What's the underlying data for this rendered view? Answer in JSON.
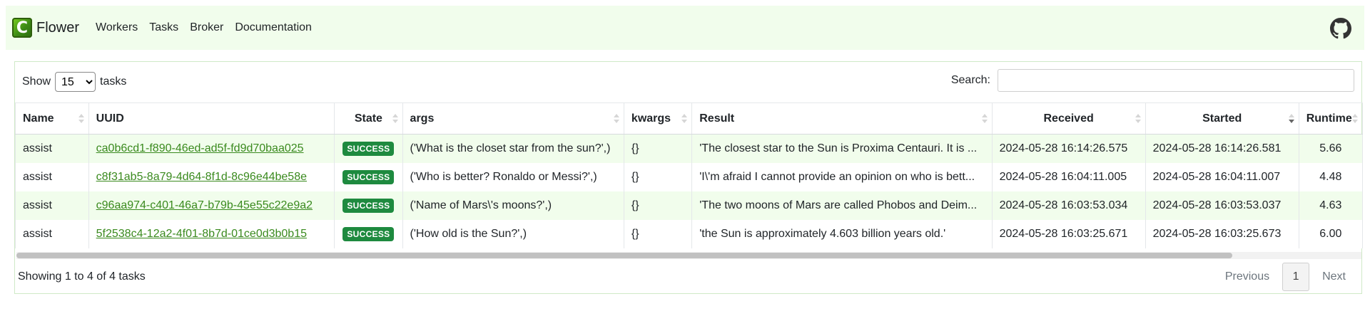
{
  "navbar": {
    "brand_letter": "C",
    "brand_name": "Flower",
    "links": [
      "Workers",
      "Tasks",
      "Broker",
      "Documentation"
    ]
  },
  "controls": {
    "show_label": "Show",
    "page_length": "15",
    "tasks_label": "tasks",
    "search_label": "Search:",
    "search_value": ""
  },
  "columns": [
    "Name",
    "UUID",
    "State",
    "args",
    "kwargs",
    "Result",
    "Received",
    "Started",
    "Runtime"
  ],
  "rows": [
    {
      "name": "assist",
      "uuid": "ca0b6cd1-f890-46ed-ad5f-fd9d70baa025",
      "state": "SUCCESS",
      "args": "('What is the closet star from the sun?',)",
      "kwargs": "{}",
      "result": "'The closest star to the Sun is Proxima Centauri. It is ...",
      "received": "2024-05-28 16:14:26.575",
      "started": "2024-05-28 16:14:26.581",
      "runtime": "5.66"
    },
    {
      "name": "assist",
      "uuid": "c8f31ab5-8a79-4d64-8f1d-8c96e44be58e",
      "state": "SUCCESS",
      "args": "('Who is better? Ronaldo or Messi?',)",
      "kwargs": "{}",
      "result": "'I\\'m afraid I cannot provide an opinion on who is bett...",
      "received": "2024-05-28 16:04:11.005",
      "started": "2024-05-28 16:04:11.007",
      "runtime": "4.48"
    },
    {
      "name": "assist",
      "uuid": "c96aa974-c401-46a7-b79b-45e55c22e9a2",
      "state": "SUCCESS",
      "args": "('Name of Mars\\'s moons?',)",
      "kwargs": "{}",
      "result": "'The two moons of Mars are called Phobos and Deim...",
      "received": "2024-05-28 16:03:53.034",
      "started": "2024-05-28 16:03:53.037",
      "runtime": "4.63"
    },
    {
      "name": "assist",
      "uuid": "5f2538c4-12a2-4f01-8b7d-01ce0d3b0b15",
      "state": "SUCCESS",
      "args": "('How old is the Sun?',)",
      "kwargs": "{}",
      "result": "'the Sun is approximately 4.603 billion years old.'",
      "received": "2024-05-28 16:03:25.671",
      "started": "2024-05-28 16:03:25.673",
      "runtime": "6.00"
    }
  ],
  "footer": {
    "info": "Showing 1 to 4 of 4 tasks",
    "previous": "Previous",
    "current_page": "1",
    "next": "Next"
  },
  "colors": {
    "accent": "#3a8a1e",
    "navbar_bg": "#f1fdec",
    "badge": "#1e8a3f"
  },
  "icons": {
    "github": "github-icon",
    "sort": "sort-icon"
  }
}
